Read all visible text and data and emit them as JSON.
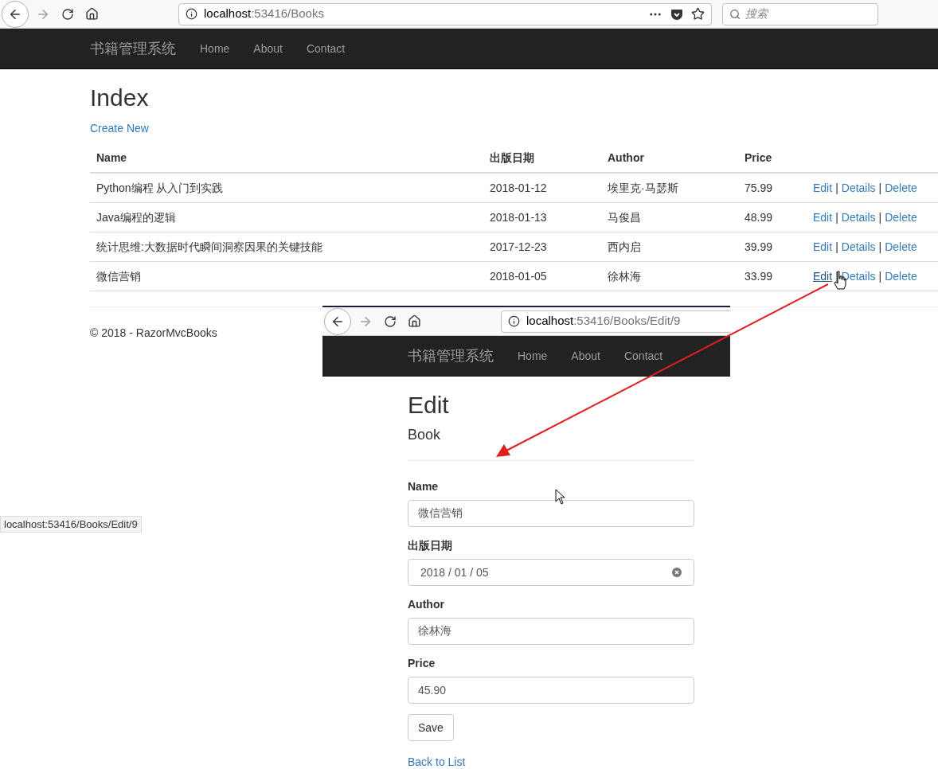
{
  "browser": {
    "url_host": "localhost",
    "url_path": ":53416/Books",
    "search_placeholder": "搜索"
  },
  "navbar": {
    "brand": "书籍管理系统",
    "links": [
      "Home",
      "About",
      "Contact"
    ]
  },
  "page": {
    "title": "Index",
    "create_link": "Create New",
    "table": {
      "columns": [
        "Name",
        "出版日期",
        "Author",
        "Price"
      ],
      "rows": [
        {
          "cells": [
            "Python编程 从入门到实践",
            "2018-01-12",
            "埃里克·马瑟斯",
            "75.99"
          ],
          "actions": [
            {
              "kind": "link",
              "text": "Edit",
              "hovered": false
            },
            {
              "kind": "separator",
              "text": "|"
            },
            {
              "kind": "link",
              "text": "Details",
              "hovered": false
            },
            {
              "kind": "separator",
              "text": "|"
            },
            {
              "kind": "link",
              "text": "Delete",
              "hovered": false
            }
          ]
        },
        {
          "cells": [
            "Java编程的逻辑",
            "2018-01-13",
            "马俊昌",
            "48.99"
          ],
          "actions": [
            {
              "kind": "link",
              "text": "Edit",
              "hovered": false
            },
            {
              "kind": "separator",
              "text": "|"
            },
            {
              "kind": "link",
              "text": "Details",
              "hovered": false
            },
            {
              "kind": "separator",
              "text": "|"
            },
            {
              "kind": "link",
              "text": "Delete",
              "hovered": false
            }
          ]
        },
        {
          "cells": [
            "统计思维:大数据时代瞬间洞察因果的关键技能",
            "2017-12-23",
            "西内启",
            "39.99"
          ],
          "actions": [
            {
              "kind": "link",
              "text": "Edit",
              "hovered": false
            },
            {
              "kind": "separator",
              "text": "|"
            },
            {
              "kind": "link",
              "text": "Details",
              "hovered": false
            },
            {
              "kind": "separator",
              "text": "|"
            },
            {
              "kind": "link",
              "text": "Delete",
              "hovered": false
            }
          ]
        },
        {
          "cells": [
            "微信营销",
            "2018-01-05",
            "徐林海",
            "33.99"
          ],
          "actions": [
            {
              "kind": "link",
              "text": "Edit",
              "hovered": true
            },
            {
              "kind": "separator",
              "text": "|"
            },
            {
              "kind": "link",
              "text": "Details",
              "hovered": false
            },
            {
              "kind": "separator",
              "text": "|"
            },
            {
              "kind": "link",
              "text": "Delete",
              "hovered": false
            }
          ]
        }
      ]
    }
  },
  "footer": "© 2018 - RazorMvcBooks",
  "status_url": "localhost:53416/Books/Edit/9",
  "edit_window": {
    "url_host": "localhost",
    "url_path": ":53416/Books/Edit/9",
    "navbar": {
      "brand": "书籍管理系统",
      "links": [
        "Home",
        "About",
        "Contact"
      ]
    },
    "title": "Edit",
    "subtitle": "Book",
    "fields": [
      {
        "kind": "text",
        "label": "Name",
        "value": "微信营销"
      },
      {
        "kind": "date",
        "label": "出版日期",
        "value": "2018 / 01 / 05"
      },
      {
        "kind": "text",
        "label": "Author",
        "value": "徐林海"
      },
      {
        "kind": "text",
        "label": "Price",
        "value": "45.90"
      }
    ],
    "save": "Save",
    "back_link": "Back to List"
  }
}
